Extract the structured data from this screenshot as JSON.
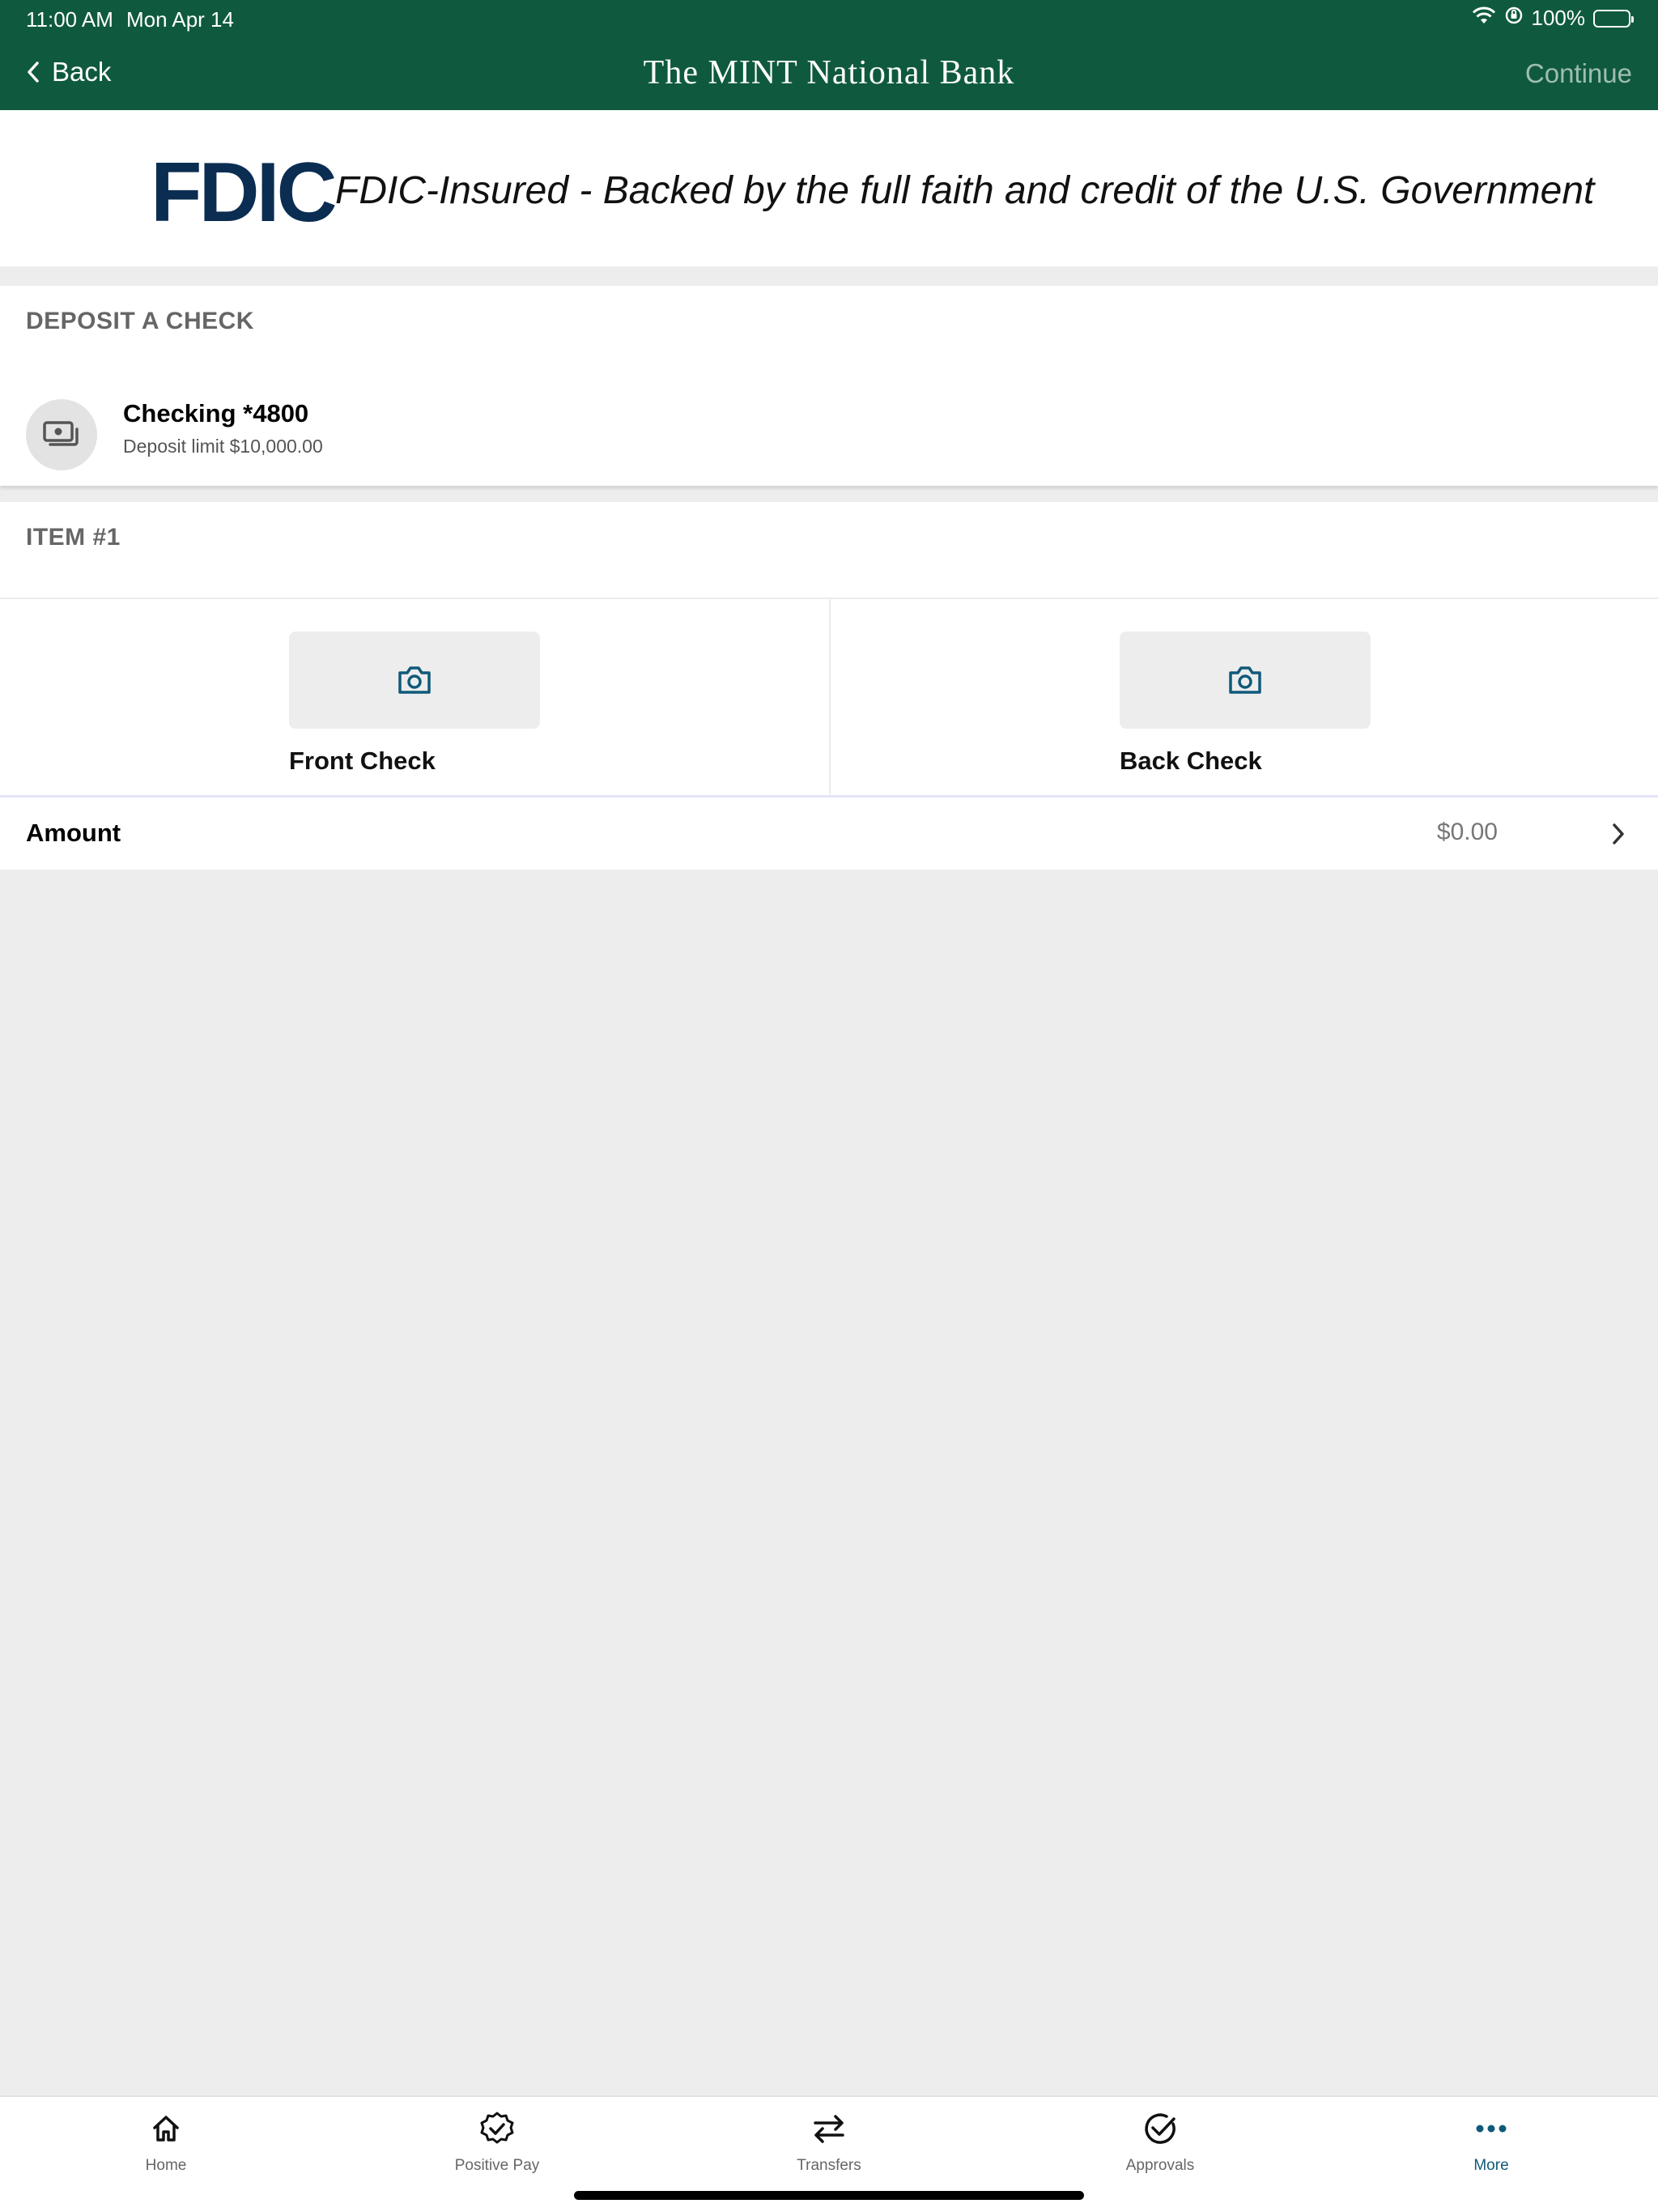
{
  "status_bar": {
    "time": "11:00 AM",
    "date": "Mon Apr 14",
    "battery": "100%"
  },
  "nav": {
    "back_label": "Back",
    "title": "The MINT National Bank",
    "continue_label": "Continue"
  },
  "fdic": {
    "logo_text": "FDIC",
    "text": "FDIC-Insured - Backed by the full faith and credit of the U.S. Government"
  },
  "deposit": {
    "section_title": "DEPOSIT A CHECK",
    "account_name": "Checking *4800",
    "deposit_limit": "Deposit limit $10,000.00"
  },
  "item": {
    "title": "ITEM #1",
    "front_label": "Front Check",
    "back_label": "Back Check",
    "amount_label": "Amount",
    "amount_value": "$0.00"
  },
  "tabs": [
    {
      "label": "Home",
      "icon": "home-icon"
    },
    {
      "label": "Positive Pay",
      "icon": "badge-check-icon"
    },
    {
      "label": "Transfers",
      "icon": "transfer-arrows-icon"
    },
    {
      "label": "Approvals",
      "icon": "check-circle-icon"
    },
    {
      "label": "More",
      "icon": "more-dots-icon",
      "active": true
    }
  ],
  "colors": {
    "brand_green": "#0f5a3e",
    "fdic_navy": "#0b2d52",
    "accent_blue": "#0f5a7a"
  }
}
